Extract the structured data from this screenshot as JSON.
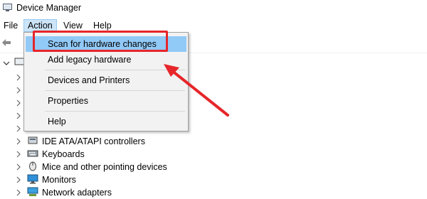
{
  "window": {
    "title": "Device Manager"
  },
  "menu": {
    "items": [
      {
        "label": "File"
      },
      {
        "label": "Action"
      },
      {
        "label": "View"
      },
      {
        "label": "Help"
      }
    ]
  },
  "action_menu": {
    "items": [
      {
        "label": "Scan for hardware changes"
      },
      {
        "label": "Add legacy hardware"
      },
      {
        "label": "Devices and Printers"
      },
      {
        "label": "Properties"
      },
      {
        "label": "Help"
      }
    ]
  },
  "tree": {
    "items": [
      {
        "label": "IDE ATA/ATAPI controllers",
        "icon": "ide-controller-icon"
      },
      {
        "label": "Keyboards",
        "icon": "keyboard-icon"
      },
      {
        "label": "Mice and other pointing devices",
        "icon": "mouse-icon"
      },
      {
        "label": "Monitors",
        "icon": "monitor-icon"
      },
      {
        "label": "Network adapters",
        "icon": "network-adapter-icon"
      }
    ]
  },
  "colors": {
    "highlight": "#91c9f7",
    "annotation_red": "#e6262a",
    "menu_active": "#cce4f7"
  }
}
